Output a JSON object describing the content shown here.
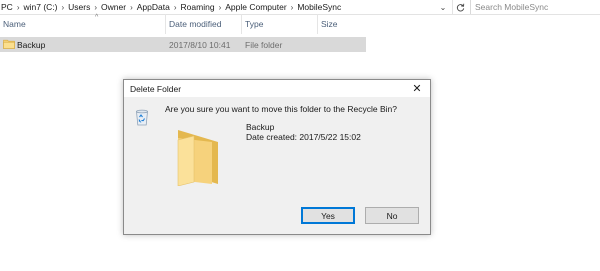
{
  "breadcrumbs": [
    "PC",
    "win7 (C:)",
    "Users",
    "Owner",
    "AppData",
    "Roaming",
    "Apple Computer",
    "MobileSync"
  ],
  "address_bar": {
    "dropdown_icon": "chevron-down-icon",
    "refresh_icon": "refresh-icon"
  },
  "search": {
    "placeholder": "Search MobileSync",
    "value": ""
  },
  "columns": {
    "name": "Name",
    "date": "Date modified",
    "type": "Type",
    "size": "Size"
  },
  "files": [
    {
      "name": "Backup",
      "date_modified": "2017/8/10 10:41",
      "type": "File folder",
      "size": ""
    }
  ],
  "dialog": {
    "title": "Delete Folder",
    "question": "Are you sure you want to move this folder to the Recycle Bin?",
    "item_name": "Backup",
    "item_date": "Date created: 2017/5/22 15:02",
    "yes_label": "Yes",
    "no_label": "No",
    "close_glyph": "✕"
  },
  "colors": {
    "selection": "#d9d9d9",
    "folder": "#f5d27a",
    "dialog_bg": "#f0f0f0",
    "accent": "#0078d7"
  }
}
